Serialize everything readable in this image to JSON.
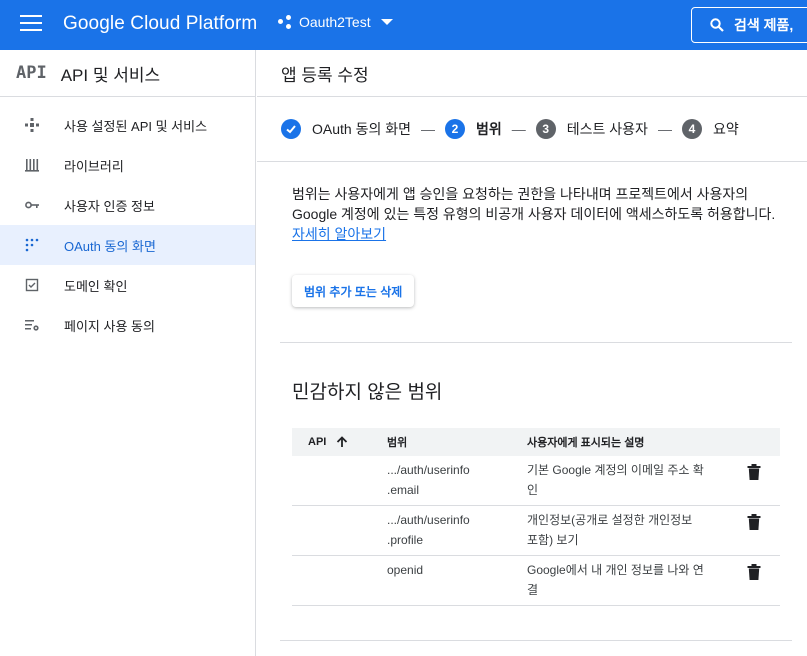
{
  "header": {
    "brand": "Google Cloud Platform",
    "project": "Oauth2Test",
    "search_label": "검색   제품,",
    "accent": "#1a73e8"
  },
  "sidebar": {
    "logo": "API",
    "title": "API 및 서비스",
    "items": [
      {
        "label": "사용 설정된 API 및 서비스",
        "icon": "diamond-arrows-icon"
      },
      {
        "label": "라이브러리",
        "icon": "library-icon"
      },
      {
        "label": "사용자 인증 정보",
        "icon": "key-icon"
      },
      {
        "label": "OAuth 동의 화면",
        "icon": "dots-grid-icon",
        "active": true
      },
      {
        "label": "도메인 확인",
        "icon": "checkbox-icon"
      },
      {
        "label": "페이지 사용 동의",
        "icon": "list-settings-icon"
      }
    ]
  },
  "main": {
    "title": "앱 등록 수정",
    "steps": [
      {
        "label": "OAuth 동의 화면",
        "state": "done"
      },
      {
        "label": "범위",
        "number": "2",
        "state": "active"
      },
      {
        "label": "테스트 사용자",
        "number": "3",
        "state": "pending"
      },
      {
        "label": "요약",
        "number": "4",
        "state": "pending"
      }
    ],
    "step_separator": "—",
    "description_line1": "범위는 사용자에게 앱 승인을 요청하는 권한을 나타내며 프로젝트에서 사용자의",
    "description_line2": "Google 계정에 있는 특정 유형의 비공개 사용자 데이터에 액세스하도록 허용합니다.",
    "learn_more": "자세히 알아보기",
    "scope_button": "범위 추가 또는 삭제",
    "section_title": "민감하지 않은 범위",
    "table": {
      "headers": {
        "api": "API",
        "scope": "범위",
        "desc": "사용자에게 표시되는 설명"
      },
      "rows": [
        {
          "api": "",
          "scope_1": ".../auth/userinfo",
          "scope_2": ".email",
          "desc_1": "기본 Google 계정의 이메일 주소 확",
          "desc_2": "인"
        },
        {
          "api": "",
          "scope_1": ".../auth/userinfo",
          "scope_2": ".profile",
          "desc_1": "개인정보(공개로 설정한 개인정보",
          "desc_2": "포함) 보기"
        },
        {
          "api": "",
          "scope_1": "openid",
          "scope_2": "",
          "desc_1": "Google에서 내 개인 정보를 나와 연",
          "desc_2": "결"
        }
      ]
    }
  }
}
